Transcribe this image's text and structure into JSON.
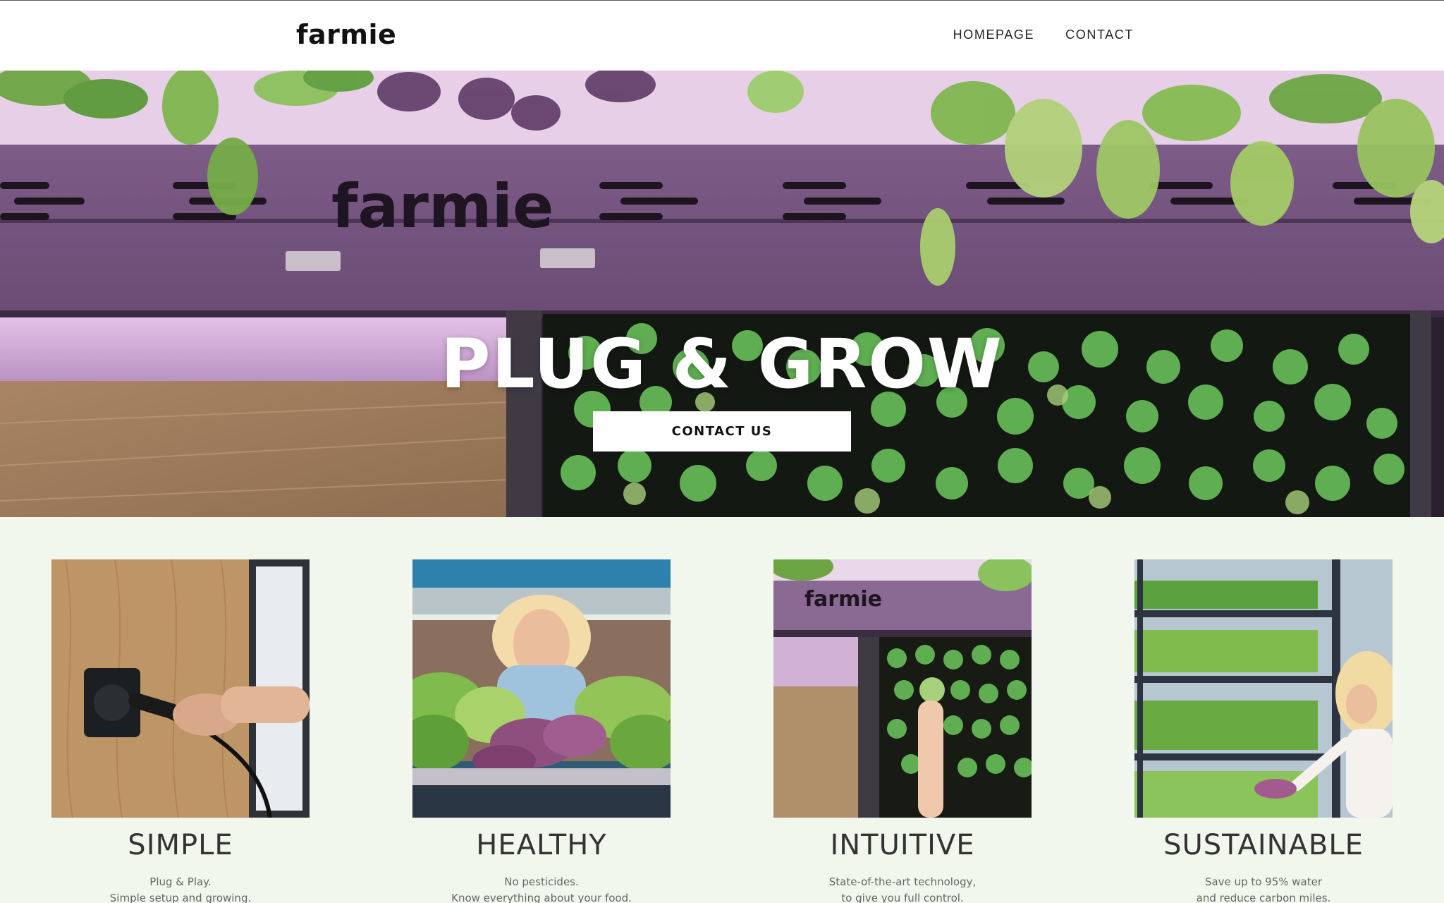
{
  "header": {
    "logo": "farmie",
    "nav": [
      {
        "label": "HOMEPAGE"
      },
      {
        "label": "CONTACT"
      }
    ]
  },
  "hero": {
    "title": "PLUG & GROW",
    "cta_label": "CONTACT US",
    "machine_logo": "farmie"
  },
  "features": [
    {
      "title": "SIMPLE",
      "line1": "Plug & Play.",
      "line2": "Simple setup and growing."
    },
    {
      "title": "HEALTHY",
      "line1": "No pesticides.",
      "line2": "Know everything about your food."
    },
    {
      "title": "INTUITIVE",
      "line1": "State-of-the-art technology,",
      "line2": "to give you full control."
    },
    {
      "title": "SUSTAINABLE",
      "line1": "Save up to 95% water",
      "line2": "and reduce carbon miles."
    }
  ],
  "colors": {
    "page_background": "#f1f7ec",
    "header_background": "#ffffff",
    "hero_purple": "#8a6c94",
    "leaf_green": "#6da544",
    "cta_background": "#ffffff"
  }
}
